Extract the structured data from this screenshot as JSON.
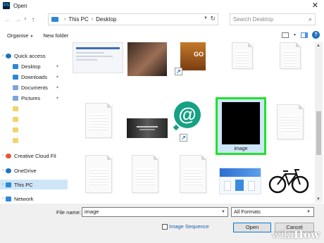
{
  "window": {
    "app_icon": "PS",
    "title": "Open",
    "close_glyph": "✕"
  },
  "nav": {
    "back_glyph": "←",
    "forward_glyph": "→",
    "recent_glyph": "˅",
    "up_glyph": "↑",
    "breadcrumbs": [
      "This PC",
      "Desktop"
    ],
    "refresh_glyph": "↻",
    "search_placeholder": "Search Desktop",
    "search_glyph": "⌕"
  },
  "toolbar": {
    "organise": "Organise",
    "new_folder": "New folder",
    "help": "?"
  },
  "sidebar": {
    "items": [
      {
        "label": "Quick access",
        "icon": "star-icon",
        "color": "#1e73be",
        "pinned": false
      },
      {
        "label": "Desktop",
        "icon": "desktop-folder-icon",
        "color": "#2b88d8",
        "pinned": true
      },
      {
        "label": "Downloads",
        "icon": "download-folder-icon",
        "color": "#2b88d8",
        "pinned": true
      },
      {
        "label": "Documents",
        "icon": "documents-folder-icon",
        "color": "#7aa7d8",
        "pinned": true
      },
      {
        "label": "Pictures",
        "icon": "pictures-folder-icon",
        "color": "#7aa7d8",
        "pinned": true
      },
      {
        "label": "",
        "icon": "folder-icon",
        "color": "#f3d36b",
        "pinned": false
      },
      {
        "label": "",
        "icon": "folder-icon",
        "color": "#f3d36b",
        "pinned": false
      },
      {
        "label": "",
        "icon": "folder-icon",
        "color": "#f3d36b",
        "pinned": false
      },
      {
        "label": "",
        "icon": "folder-icon",
        "color": "#f3d36b",
        "pinned": false
      },
      {
        "label": "Creative Cloud Fil",
        "icon": "creative-cloud-icon",
        "color": "#e8542e",
        "pinned": false
      },
      {
        "label": "OneDrive",
        "icon": "onedrive-icon",
        "color": "#1e73be",
        "pinned": false
      },
      {
        "label": "This PC",
        "icon": "this-pc-icon",
        "color": "#2b88d8",
        "pinned": false,
        "selected": true
      },
      {
        "label": "Network",
        "icon": "network-icon",
        "color": "#2b88d8",
        "pinned": false
      }
    ]
  },
  "files": {
    "selected_label": "image",
    "shortcut_glyph": "↗",
    "at_glyph": "@",
    "game_logo_text": "GO"
  },
  "bottom": {
    "file_name_label": "File name:",
    "file_name_value": "image",
    "format_value": "All Formats",
    "image_sequence_label": "Image Sequence",
    "open_label": "Open",
    "cancel_label": "Cancel"
  },
  "watermark": {
    "wiki": "wiki",
    "how": "How"
  },
  "colors": {
    "selection_outline": "#22e22a",
    "selection_fill": "#cde6f7",
    "accent": "#0078d7"
  }
}
